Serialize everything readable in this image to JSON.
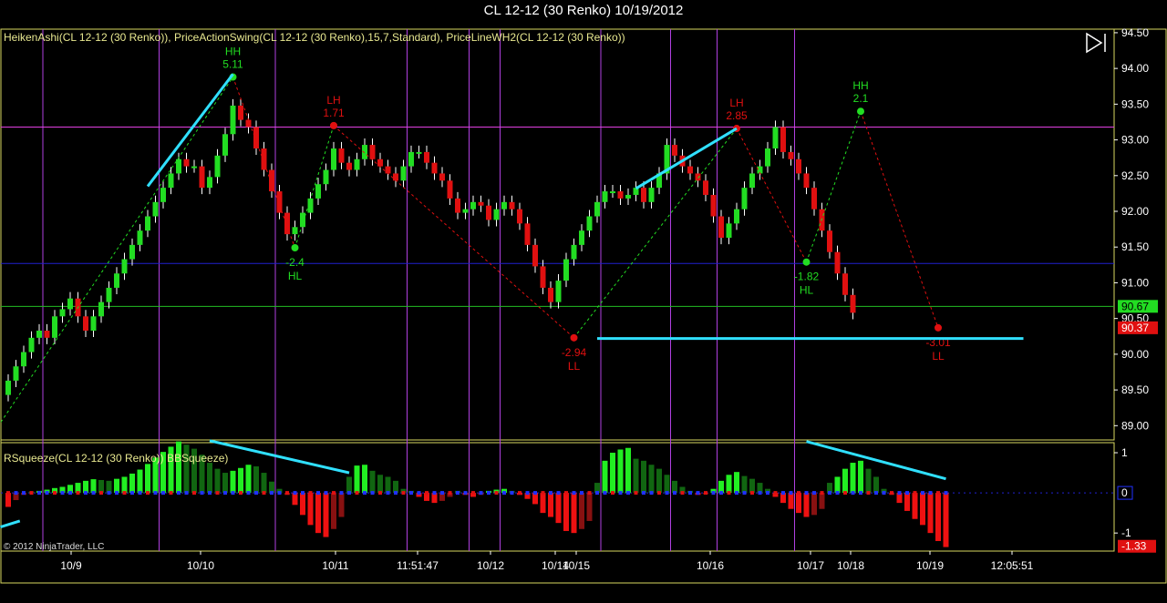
{
  "title": "CL 12-12 (30 Renko)  10/19/2012",
  "colors": {
    "background": "#000000",
    "border": "#d8d860",
    "up": "#22dd22",
    "down": "#e01010",
    "session": "#b040e0",
    "resistance": "#e040e0",
    "support_blue": "#2020d0",
    "price_line": "#22bb22",
    "trend": "#30e0ff",
    "axis_text": "#ffffff"
  },
  "chart_data": [
    {
      "type": "candlestick",
      "panel": "price",
      "indicator_label": "HeikenAshi(CL 12-12 (30 Renko)),  PriceActionSwing(CL 12-12 (30 Renko),15,7,Standard),  PriceLineWH2(CL 12-12 (30 Renko))",
      "ylim": [
        88.8,
        94.55
      ],
      "y_ticks": [
        "94.50",
        "94.00",
        "93.50",
        "93.00",
        "92.50",
        "92.00",
        "91.50",
        "91.00",
        "90.50",
        "90.00",
        "89.50",
        "89.00"
      ],
      "x_labels": [
        "10/9",
        "10/10",
        "10/11",
        "11:51:47",
        "10/12",
        "10/14",
        "10/15",
        "10/16",
        "10/17",
        "10/18",
        "10/19",
        "12:05:51"
      ],
      "session_separators_at_bar": [
        4,
        19,
        34,
        51,
        59,
        63,
        76,
        85,
        91,
        101
      ],
      "closes": [
        89.63,
        89.83,
        90.03,
        90.23,
        90.33,
        90.23,
        90.53,
        90.63,
        90.78,
        90.53,
        90.33,
        90.53,
        90.73,
        90.93,
        91.13,
        91.33,
        91.53,
        91.73,
        91.93,
        92.13,
        92.33,
        92.53,
        92.73,
        92.63,
        92.63,
        92.33,
        92.48,
        92.78,
        93.08,
        93.48,
        93.28,
        93.18,
        92.88,
        92.58,
        92.28,
        91.98,
        91.68,
        91.78,
        91.98,
        92.18,
        92.38,
        92.58,
        92.88,
        92.68,
        92.58,
        92.73,
        92.93,
        92.73,
        92.63,
        92.53,
        92.43,
        92.63,
        92.83,
        92.83,
        92.68,
        92.53,
        92.43,
        92.18,
        91.98,
        92.03,
        92.13,
        92.08,
        91.88,
        92.03,
        92.13,
        92.03,
        91.83,
        91.53,
        91.23,
        90.93,
        90.73,
        91.03,
        91.33,
        91.53,
        91.73,
        91.93,
        92.13,
        92.28,
        92.28,
        92.18,
        92.23,
        92.33,
        92.13,
        92.33,
        92.53,
        92.93,
        92.78,
        92.63,
        92.53,
        92.43,
        92.23,
        91.93,
        91.63,
        91.83,
        92.03,
        92.33,
        92.53,
        92.63,
        92.88,
        93.18,
        92.83,
        92.73,
        92.53,
        92.33,
        92.03,
        91.73,
        91.43,
        91.13,
        90.83,
        90.58
      ],
      "swings": [
        {
          "kind": "HH",
          "value": "5.11",
          "bar": 29,
          "price": 93.88,
          "color": "#22dd22",
          "label_pos": "above"
        },
        {
          "kind": "HL",
          "value": "-2.4",
          "bar": 37,
          "price": 91.49,
          "color": "#22dd22",
          "label_pos": "below"
        },
        {
          "kind": "LH",
          "value": "1.71",
          "bar": 42,
          "price": 93.2,
          "color": "#e01010",
          "label_pos": "above"
        },
        {
          "kind": "LL",
          "value": "-2.94",
          "bar": 73,
          "price": 90.23,
          "color": "#e01010",
          "label_pos": "below"
        },
        {
          "kind": "LH",
          "value": "2.85",
          "bar": 94,
          "price": 93.16,
          "color": "#e01010",
          "label_pos": "above"
        },
        {
          "kind": "HL",
          "value": "-1.82",
          "bar": 103,
          "price": 91.29,
          "color": "#22dd22",
          "label_pos": "below"
        },
        {
          "kind": "HH",
          "value": "2.1",
          "bar": 110,
          "price": 93.4,
          "color": "#22dd22",
          "label_pos": "above"
        },
        {
          "kind": "LL",
          "value": "-3.01",
          "bar": 120,
          "price": 90.37,
          "color": "#e01010",
          "label_pos": "below"
        }
      ],
      "horizontal_lines": [
        {
          "price": 93.18,
          "color": "#e040e0"
        },
        {
          "price": 91.27,
          "color": "#2020d0"
        },
        {
          "price": 90.67,
          "color": "#22bb22"
        }
      ],
      "trendlines": [
        {
          "from": [
            18,
            92.35
          ],
          "to": [
            29,
            93.92
          ]
        },
        {
          "from": [
            81,
            92.32
          ],
          "to": [
            94,
            93.16
          ]
        },
        {
          "from": [
            76,
            90.22
          ],
          "to": [
            131,
            90.22
          ]
        }
      ],
      "price_markers": [
        {
          "label": "90.67",
          "price": 90.67,
          "bg": "#22dd22",
          "fg": "#000000"
        },
        {
          "label": "90.37",
          "price": 90.37,
          "bg": "#e01010",
          "fg": "#ffffff"
        }
      ]
    },
    {
      "type": "bar",
      "panel": "indicator",
      "indicator_label": "RSqueeze(CL 12-12 (30 Renko)) BBSqueeze)",
      "ylim": [
        -1.45,
        1.25
      ],
      "y_ticks": [
        "1",
        "-1"
      ],
      "values": [
        -0.35,
        -0.18,
        -0.05,
        0.03,
        0.05,
        0.08,
        0.12,
        0.15,
        0.2,
        0.25,
        0.3,
        0.34,
        0.32,
        0.3,
        0.35,
        0.4,
        0.48,
        0.58,
        0.72,
        0.88,
        1.02,
        1.15,
        1.28,
        1.2,
        1.1,
        0.95,
        0.75,
        0.6,
        0.5,
        0.55,
        0.62,
        0.7,
        0.66,
        0.5,
        0.28,
        0.1,
        -0.05,
        -0.3,
        -0.55,
        -0.8,
        -1.0,
        -1.1,
        -0.9,
        -0.6,
        0.4,
        0.68,
        0.7,
        0.55,
        0.45,
        0.4,
        0.3,
        0.1,
        0.05,
        -0.1,
        -0.2,
        -0.25,
        -0.2,
        -0.1,
        0.05,
        -0.05,
        -0.1,
        -0.05,
        0.05,
        0.08,
        0.1,
        0.05,
        -0.05,
        -0.15,
        -0.28,
        -0.5,
        -0.6,
        -0.75,
        -0.95,
        -1.0,
        -0.9,
        -0.7,
        0.25,
        0.8,
        1.0,
        1.08,
        1.12,
        0.85,
        0.8,
        0.7,
        0.6,
        0.45,
        0.3,
        0.15,
        0.05,
        -0.05,
        -0.03,
        0.1,
        0.3,
        0.45,
        0.52,
        0.42,
        0.35,
        0.25,
        0.1,
        -0.1,
        -0.25,
        -0.4,
        -0.5,
        -0.6,
        -0.55,
        -0.4,
        0.25,
        0.4,
        0.6,
        0.75,
        0.8,
        0.6,
        0.4,
        0.1,
        -0.05,
        -0.25,
        -0.45,
        -0.65,
        -0.8,
        -1.0,
        -1.2,
        -1.35
      ],
      "last_value_marker": {
        "label": "0",
        "bg": "#000000",
        "fg": "#ffffff",
        "value": 0
      },
      "value_marker": {
        "label": "-1.33",
        "bg": "#e01010",
        "fg": "#ffffff",
        "value": -1.33
      },
      "trendlines": [
        {
          "from": [
            26,
            1.3
          ],
          "to": [
            44,
            0.5
          ]
        },
        {
          "from": [
            103,
            1.28
          ],
          "to": [
            121,
            0.35
          ]
        },
        {
          "from": [
            -1,
            -0.85
          ],
          "to": [
            1.5,
            -0.7
          ]
        }
      ]
    }
  ],
  "footer": {
    "copyright": "© 2012 NinjaTrader, LLC"
  },
  "controls": {
    "scroll_end_icon": "skip-to-end-icon"
  }
}
